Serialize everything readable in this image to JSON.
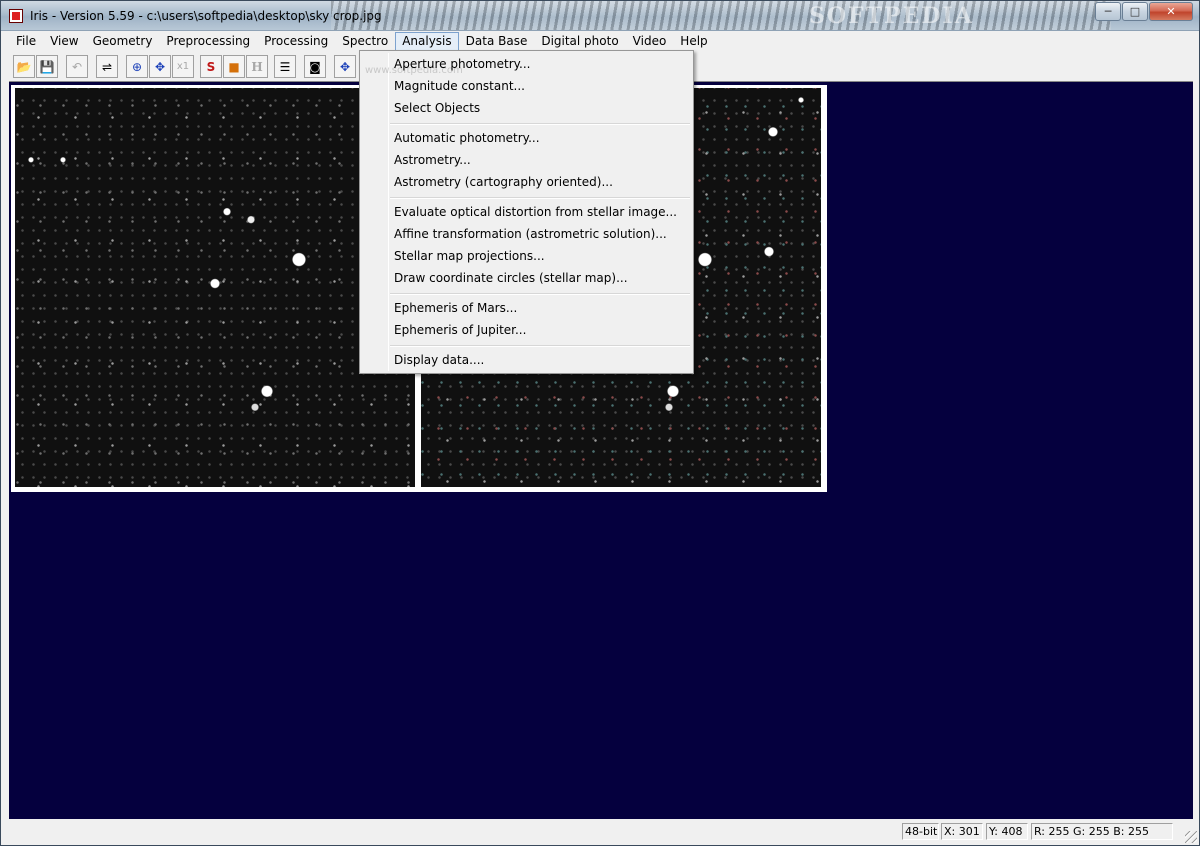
{
  "window": {
    "title": "Iris - Version 5.59 - c:\\users\\softpedia\\desktop\\sky crop.jpg",
    "watermark": "SOFTPEDIA",
    "minimize": "─",
    "maximize": "□",
    "close": "✕"
  },
  "menubar": {
    "items": [
      "File",
      "View",
      "Geometry",
      "Preprocessing",
      "Processing",
      "Spectro",
      "Analysis",
      "Data Base",
      "Digital photo",
      "Video",
      "Help"
    ]
  },
  "toolbar": {
    "buttons": [
      {
        "icon": "open-folder-icon",
        "glyph": "📂"
      },
      {
        "icon": "save-icon",
        "glyph": "💾"
      },
      {
        "icon": "undo-icon",
        "glyph": "↶"
      },
      {
        "icon": "threshold-sliders-icon",
        "glyph": "⇌"
      },
      {
        "icon": "zoom-in-icon",
        "glyph": "⊕"
      },
      {
        "icon": "zoom-out-icon",
        "glyph": "✥"
      },
      {
        "icon": "zoom-1x-icon",
        "glyph": "x1"
      },
      {
        "icon": "snapshot-s-icon",
        "glyph": "S"
      },
      {
        "icon": "stop-icon",
        "glyph": "■"
      },
      {
        "icon": "histogram-h-icon",
        "glyph": "H"
      },
      {
        "icon": "list-icon",
        "glyph": "☰"
      },
      {
        "icon": "camera-icon",
        "glyph": "◙"
      },
      {
        "icon": "move-icon",
        "glyph": "✥"
      }
    ]
  },
  "analysis_menu": {
    "watermark": "www.softpedia.com",
    "groups": [
      [
        "Aperture photometry...",
        "Magnitude constant...",
        "Select Objects"
      ],
      [
        "Automatic photometry...",
        "Astrometry...",
        "Astrometry (cartography oriented)..."
      ],
      [
        "Evaluate optical distortion from stellar image...",
        "Affine transformation (astrometric solution)...",
        "Stellar map projections...",
        "Draw coordinate circles (stellar map)..."
      ],
      [
        "Ephemeris of Mars...",
        "Ephemeris of Jupiter..."
      ],
      [
        "Display data...."
      ]
    ]
  },
  "statusbar": {
    "bitdepth": "48-bits",
    "x": "X: 301",
    "y": "Y: 408",
    "rgb": "R: 255  G: 255  B: 255"
  },
  "colors": {
    "workspace_bg": "#05003e",
    "menu_active_border": "#7da2ce"
  }
}
